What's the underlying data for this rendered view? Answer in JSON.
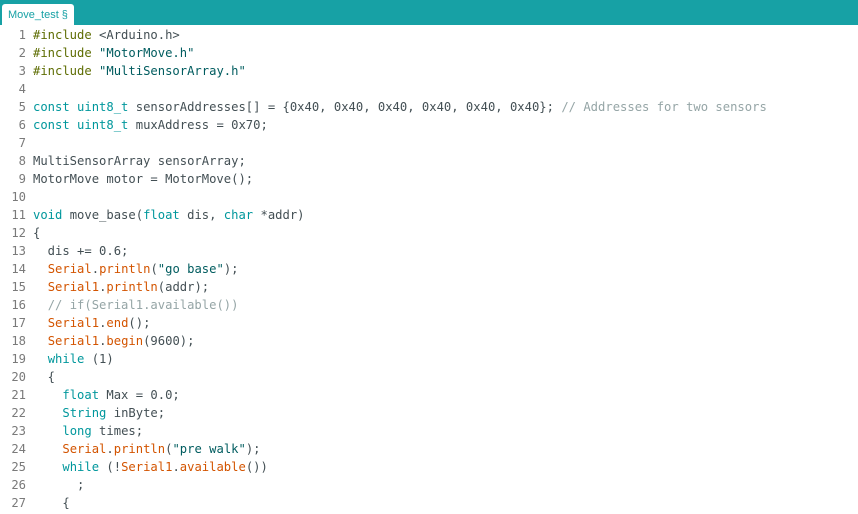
{
  "tab": {
    "label": "Move_test §"
  },
  "editor": {
    "colors": {
      "kw": "#00979c",
      "pp": "#5e6d03",
      "fn": "#d35400",
      "st": "#005c5f",
      "cm": "#95a5a6",
      "tx": "#434f54"
    },
    "lines": [
      {
        "num": "1",
        "tokens": [
          [
            "pp",
            "#include"
          ],
          [
            "tx",
            " <Arduino.h>"
          ]
        ]
      },
      {
        "num": "2",
        "tokens": [
          [
            "pp",
            "#include"
          ],
          [
            "tx",
            " "
          ],
          [
            "st",
            "\"MotorMove.h\""
          ]
        ]
      },
      {
        "num": "3",
        "tokens": [
          [
            "pp",
            "#include"
          ],
          [
            "tx",
            " "
          ],
          [
            "st",
            "\"MultiSensorArray.h\""
          ]
        ]
      },
      {
        "num": "4",
        "tokens": []
      },
      {
        "num": "5",
        "tokens": [
          [
            "kw",
            "const"
          ],
          [
            "tx",
            " "
          ],
          [
            "ty",
            "uint8_t"
          ],
          [
            "tx",
            " sensorAddresses[] = {0x40, 0x40, 0x40, 0x40, 0x40, 0x40}; "
          ],
          [
            "cm",
            "// Addresses for two sensors"
          ]
        ]
      },
      {
        "num": "6",
        "tokens": [
          [
            "kw",
            "const"
          ],
          [
            "tx",
            " "
          ],
          [
            "ty",
            "uint8_t"
          ],
          [
            "tx",
            " muxAddress = 0x70;"
          ]
        ]
      },
      {
        "num": "7",
        "tokens": []
      },
      {
        "num": "8",
        "tokens": [
          [
            "tx",
            "MultiSensorArray sensorArray;"
          ]
        ]
      },
      {
        "num": "9",
        "tokens": [
          [
            "tx",
            "MotorMove motor = MotorMove();"
          ]
        ]
      },
      {
        "num": "10",
        "tokens": []
      },
      {
        "num": "11",
        "tokens": [
          [
            "kw",
            "void"
          ],
          [
            "tx",
            " move_base("
          ],
          [
            "kw",
            "float"
          ],
          [
            "tx",
            " dis, "
          ],
          [
            "kw",
            "char"
          ],
          [
            "tx",
            " *addr)"
          ]
        ]
      },
      {
        "num": "12",
        "tokens": [
          [
            "tx",
            "{"
          ]
        ]
      },
      {
        "num": "13",
        "tokens": [
          [
            "tx",
            "  dis += 0.6;"
          ]
        ]
      },
      {
        "num": "14",
        "tokens": [
          [
            "tx",
            "  "
          ],
          [
            "fn",
            "Serial"
          ],
          [
            "tx",
            "."
          ],
          [
            "fn",
            "println"
          ],
          [
            "tx",
            "("
          ],
          [
            "st",
            "\"go base\""
          ],
          [
            "tx",
            ");"
          ]
        ]
      },
      {
        "num": "15",
        "tokens": [
          [
            "tx",
            "  "
          ],
          [
            "fn",
            "Serial1"
          ],
          [
            "tx",
            "."
          ],
          [
            "fn",
            "println"
          ],
          [
            "tx",
            "(addr);"
          ]
        ]
      },
      {
        "num": "16",
        "tokens": [
          [
            "tx",
            "  "
          ],
          [
            "cm",
            "// if(Serial1.available())"
          ]
        ]
      },
      {
        "num": "17",
        "tokens": [
          [
            "tx",
            "  "
          ],
          [
            "fn",
            "Serial1"
          ],
          [
            "tx",
            "."
          ],
          [
            "fn",
            "end"
          ],
          [
            "tx",
            "();"
          ]
        ]
      },
      {
        "num": "18",
        "tokens": [
          [
            "tx",
            "  "
          ],
          [
            "fn",
            "Serial1"
          ],
          [
            "tx",
            "."
          ],
          [
            "fn",
            "begin"
          ],
          [
            "tx",
            "(9600);"
          ]
        ]
      },
      {
        "num": "19",
        "tokens": [
          [
            "tx",
            "  "
          ],
          [
            "kw",
            "while"
          ],
          [
            "tx",
            " (1)"
          ]
        ]
      },
      {
        "num": "20",
        "tokens": [
          [
            "tx",
            "  {"
          ]
        ]
      },
      {
        "num": "21",
        "tokens": [
          [
            "tx",
            "    "
          ],
          [
            "kw",
            "float"
          ],
          [
            "tx",
            " Max = 0.0;"
          ]
        ]
      },
      {
        "num": "22",
        "tokens": [
          [
            "tx",
            "    "
          ],
          [
            "ty",
            "String"
          ],
          [
            "tx",
            " inByte;"
          ]
        ]
      },
      {
        "num": "23",
        "tokens": [
          [
            "tx",
            "    "
          ],
          [
            "kw",
            "long"
          ],
          [
            "tx",
            " times;"
          ]
        ]
      },
      {
        "num": "24",
        "tokens": [
          [
            "tx",
            "    "
          ],
          [
            "fn",
            "Serial"
          ],
          [
            "tx",
            "."
          ],
          [
            "fn",
            "println"
          ],
          [
            "tx",
            "("
          ],
          [
            "st",
            "\"pre walk\""
          ],
          [
            "tx",
            ");"
          ]
        ]
      },
      {
        "num": "25",
        "tokens": [
          [
            "tx",
            "    "
          ],
          [
            "kw",
            "while"
          ],
          [
            "tx",
            " (!"
          ],
          [
            "fn",
            "Serial1"
          ],
          [
            "tx",
            "."
          ],
          [
            "fn",
            "available"
          ],
          [
            "tx",
            "())"
          ]
        ]
      },
      {
        "num": "26",
        "tokens": [
          [
            "tx",
            "      ;"
          ]
        ]
      },
      {
        "num": "27",
        "tokens": [
          [
            "tx",
            "    {"
          ]
        ]
      }
    ]
  }
}
